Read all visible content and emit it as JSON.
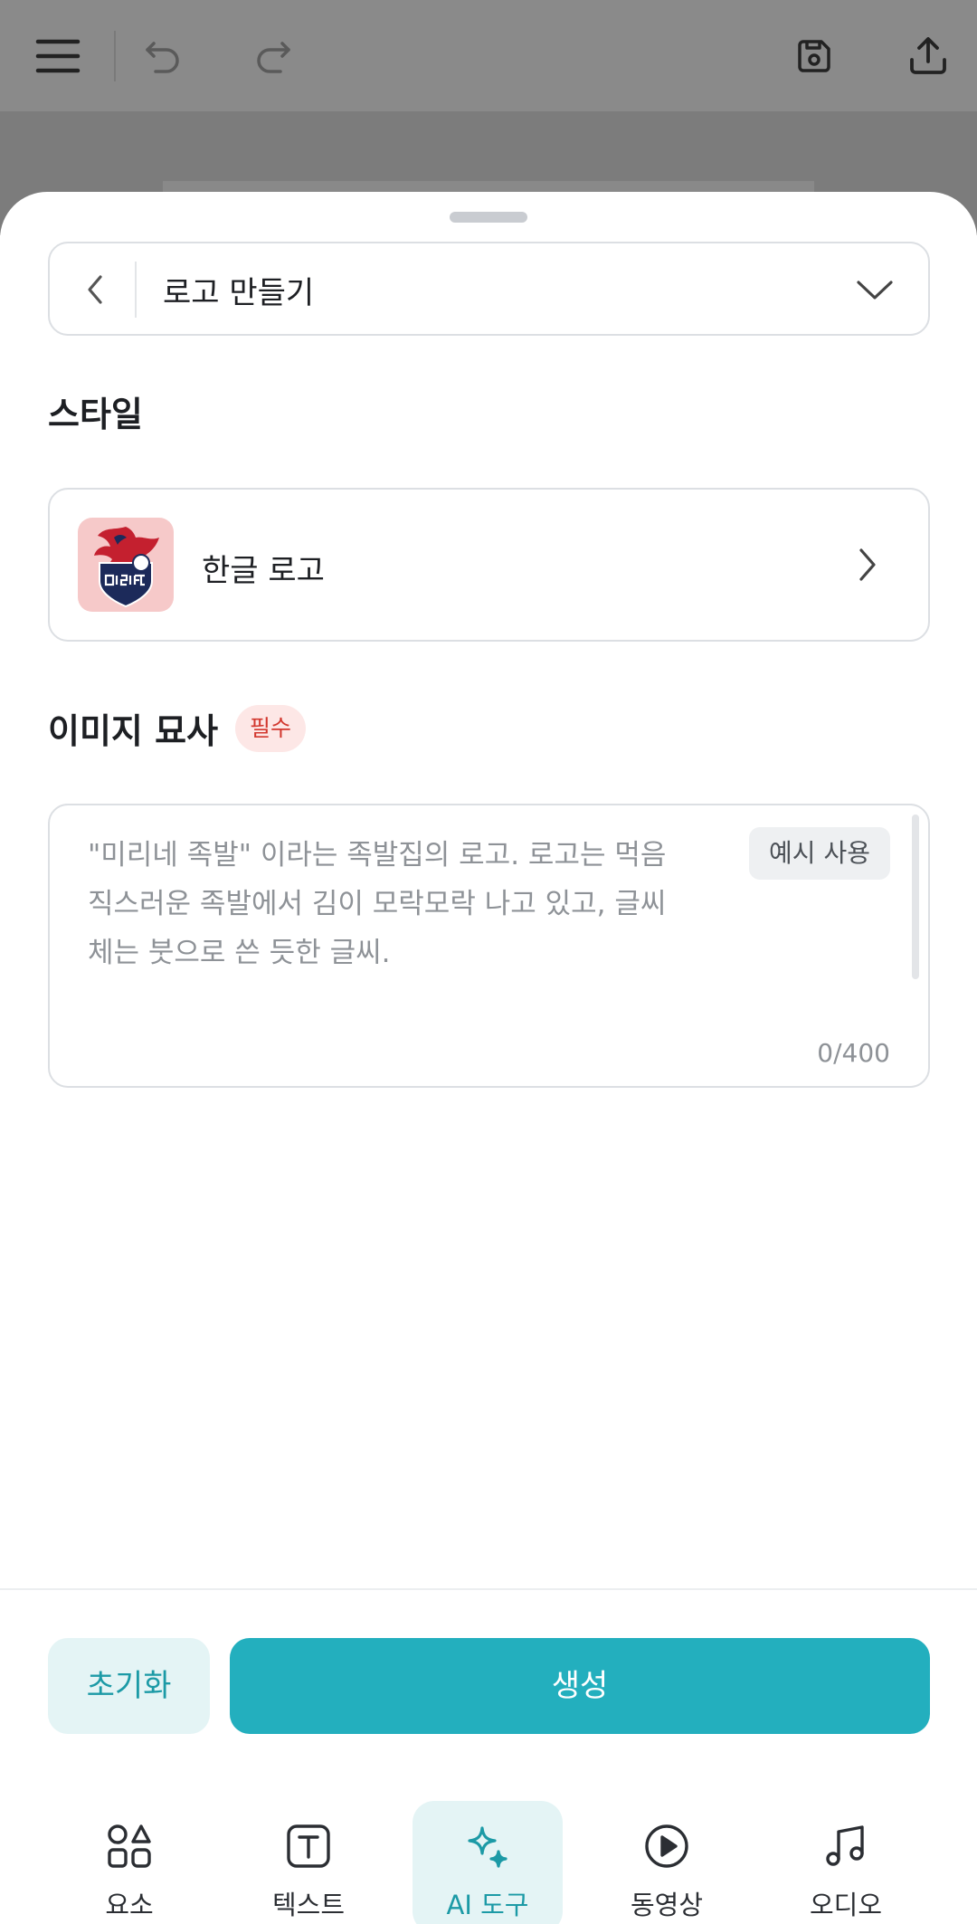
{
  "colors": {
    "accent": "#23afbe",
    "accent_light": "#e4f4f5",
    "required_badge_bg": "#fde7e6",
    "required_badge_text": "#d2382f"
  },
  "topbar": {
    "icons": [
      "menu-icon",
      "undo-icon",
      "redo-icon",
      "save-icon",
      "share-upload-icon"
    ]
  },
  "tool_selector": {
    "title": "로고 만들기"
  },
  "style_section": {
    "title": "스타일",
    "selected_style": "한글 로고",
    "thumbnail_text": "미리FC"
  },
  "description_section": {
    "title": "이미지 묘사",
    "required_badge": "필수",
    "placeholder": "\"미리네 족발\" 이라는 족발집의 로고. 로고는 먹음직스러운 족발에서 김이 모락모락 나고 있고, 글씨체는 붓으로 쓴 듯한 글씨.",
    "example_button": "예시 사용",
    "char_count": "0/400"
  },
  "actions": {
    "reset": "초기화",
    "generate": "생성"
  },
  "tabs": [
    {
      "label": "요소",
      "icon": "elements-icon",
      "active": false
    },
    {
      "label": "텍스트",
      "icon": "text-icon",
      "active": false
    },
    {
      "label": "AI 도구",
      "icon": "ai-sparkle-icon",
      "active": true
    },
    {
      "label": "동영상",
      "icon": "video-play-icon",
      "active": false
    },
    {
      "label": "오디오",
      "icon": "music-note-icon",
      "active": false
    }
  ]
}
